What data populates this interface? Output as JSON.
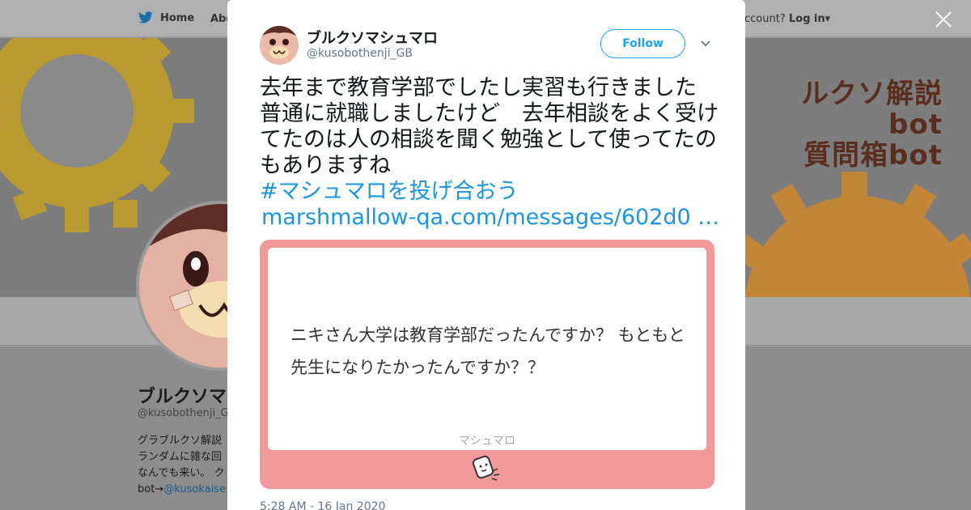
{
  "background": {
    "nav": {
      "home_label": "Home",
      "about_label": "Abo",
      "account_prefix": "ccount?",
      "login_label": "Log in"
    },
    "banner_text": [
      "ルクソ解説bot",
      "質問箱bot"
    ],
    "profile": {
      "name": "ブルクソマ",
      "handle": "@kusobothenji_G",
      "bio_lines": [
        "グラブルクソ解説",
        "ランダムに雑な回",
        "なんでも来い。 ク"
      ],
      "bio_link_prefix": "bot→",
      "bio_link": "@kusokaise"
    }
  },
  "tweet": {
    "author_name": "ブルクソマシュマロ",
    "author_handle": "@kusobothenji_GB",
    "follow_label": "Follow",
    "text": "去年まで教育学部でしたし実習も行きました　普通に就職しましたけど　去年相談をよく受けてたのは人の相談を聞く勉強として使ってたのもありますね",
    "hashtag": "#マシュマロを投げ合おう",
    "link": "marshmallow-qa.com/messages/602d0 …",
    "card": {
      "question": "ニキさん大学は教育学部だったんですか？ もともと先生になりたかったんですか？？",
      "brand": "マシュマロ"
    },
    "timestamp": "5:28 AM - 16 Jan 2020"
  },
  "colors": {
    "twitter_blue": "#1da1f2",
    "link_blue": "#1b95e0",
    "card_pink": "#f29a9a",
    "overlay_gray": "#9a9a9a"
  },
  "icons": [
    "twitter-bird-icon",
    "chevron-down-icon",
    "close-icon",
    "marshmallow-icon",
    "caret-down-icon"
  ]
}
